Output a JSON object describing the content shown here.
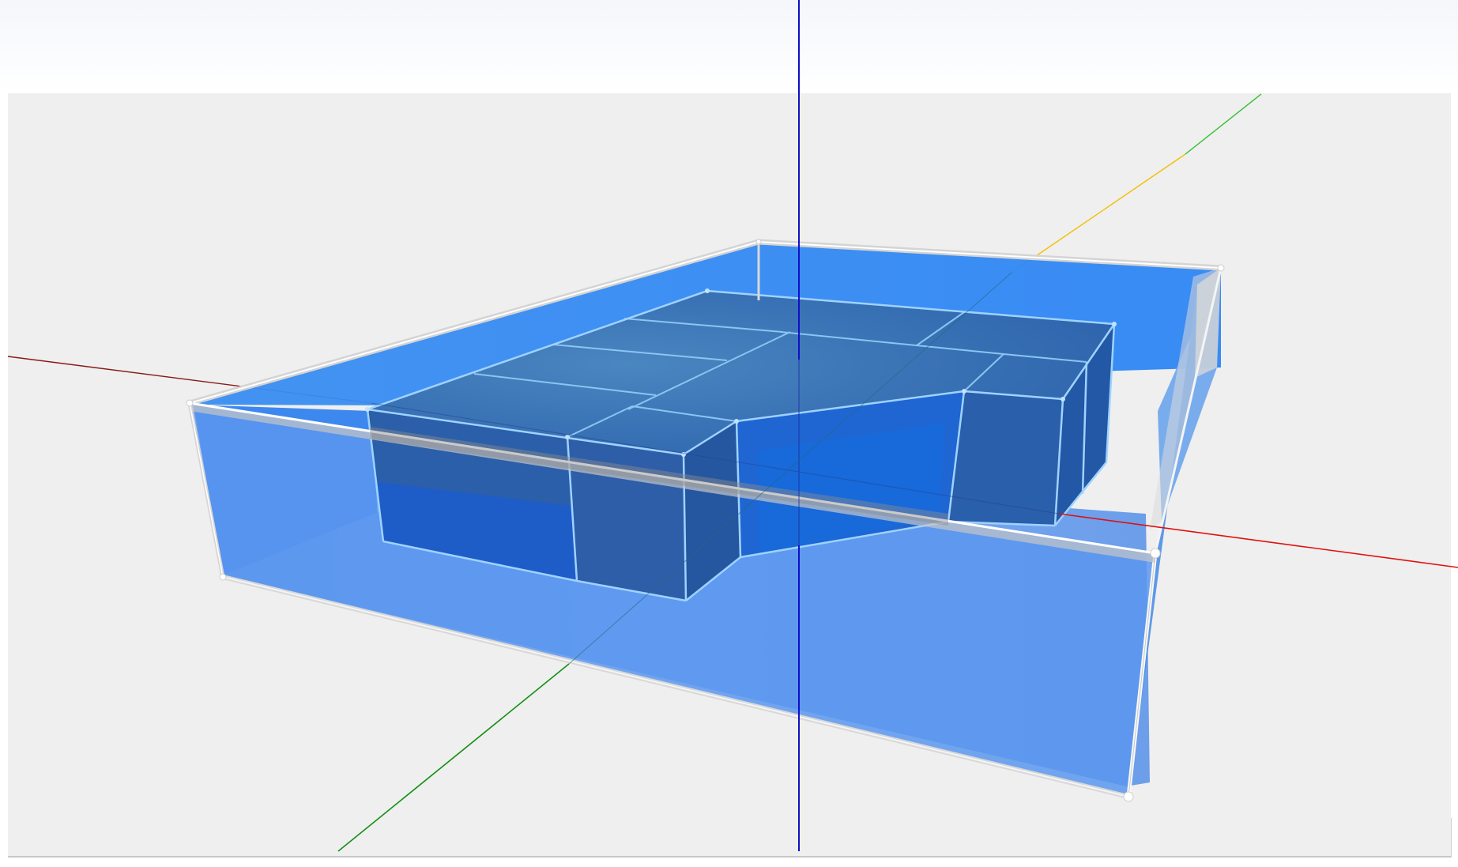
{
  "viewport": {
    "background_color": "#efefef",
    "axes": {
      "x_axis_color": "#e01010",
      "x_axis_negative_color": "#8a1010",
      "y_axis_color": "#18a018",
      "y_axis_far_color": "#f0c000",
      "z_axis_color": "#1010d0"
    },
    "outer_box": {
      "fill_color": "#2f86f0",
      "edge_color": "#ffffff",
      "frame_color": "#d8d8d8"
    },
    "inner_building": {
      "fill_color": "#2a60ac",
      "edge_color": "#9fd2ff"
    }
  }
}
